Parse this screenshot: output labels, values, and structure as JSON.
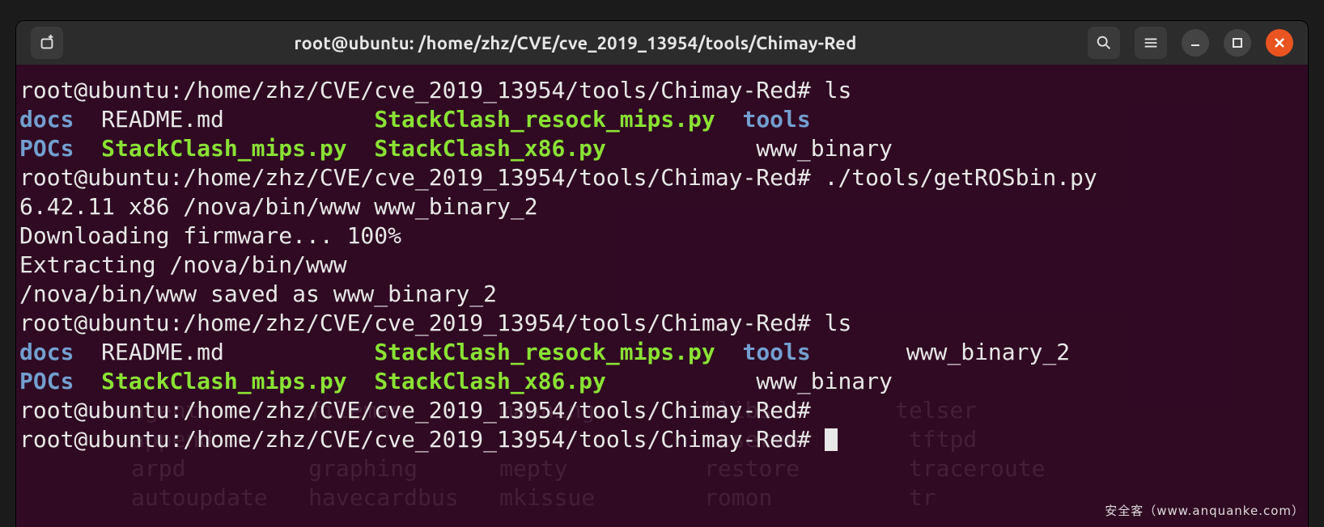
{
  "window": {
    "title": "root@ubuntu: /home/zhz/CVE/cve_2019_13954/tools/Chimay-Red"
  },
  "titlebar": {
    "newtab_icon": "new-tab-icon",
    "search_icon": "search-icon",
    "menu_icon": "hamburger-menu-icon",
    "minimize_icon": "minimize-icon",
    "maximize_icon": "maximize-icon",
    "close_icon": "close-icon"
  },
  "prompt": {
    "full": "root@ubuntu:/home/zhz/CVE/cve_2019_13954/tools/Chimay-Red# "
  },
  "session": {
    "cmd1": "ls",
    "ls1": {
      "docs": "docs",
      "readme": "README.md",
      "sc_resock": "StackClash_resock_mips.py",
      "tools": "tools",
      "pocs": "POCs",
      "sc_mips": "StackClash_mips.py",
      "sc_x86": "StackClash_x86.py",
      "www_bin": "www_binary"
    },
    "cmd2_a": "./tools/getROSbin.py ",
    "cmd2_b": "6.42.11 x86 /nova/bin/www www_binary_2",
    "out1": "Downloading firmware... 100%",
    "out2": "Extracting /nova/bin/www",
    "out3": "/nova/bin/www saved as www_binary_2",
    "cmd3": "ls",
    "ls2": {
      "docs": "docs",
      "readme": "README.md",
      "sc_resock": "StackClash_resock_mips.py",
      "tools": "tools",
      "www_bin2": "www_binary_2",
      "pocs": "POCs",
      "sc_mips": "StackClash_mips.py",
      "sc_x86": "StackClash_x86.py",
      "www_bin": "www_binary"
    }
  },
  "ghost": {
    "l1": "agent        fileman       manning       rblibs         telser",
    "l2": "append                                     cserver       tftpd",
    "l3": "arpd         graphing      mepty          restore        traceroute",
    "l4": "autoupdate   havecardbus   mkissue        romon          tr"
  },
  "watermark": "安全客（www.anquanke.com）"
}
